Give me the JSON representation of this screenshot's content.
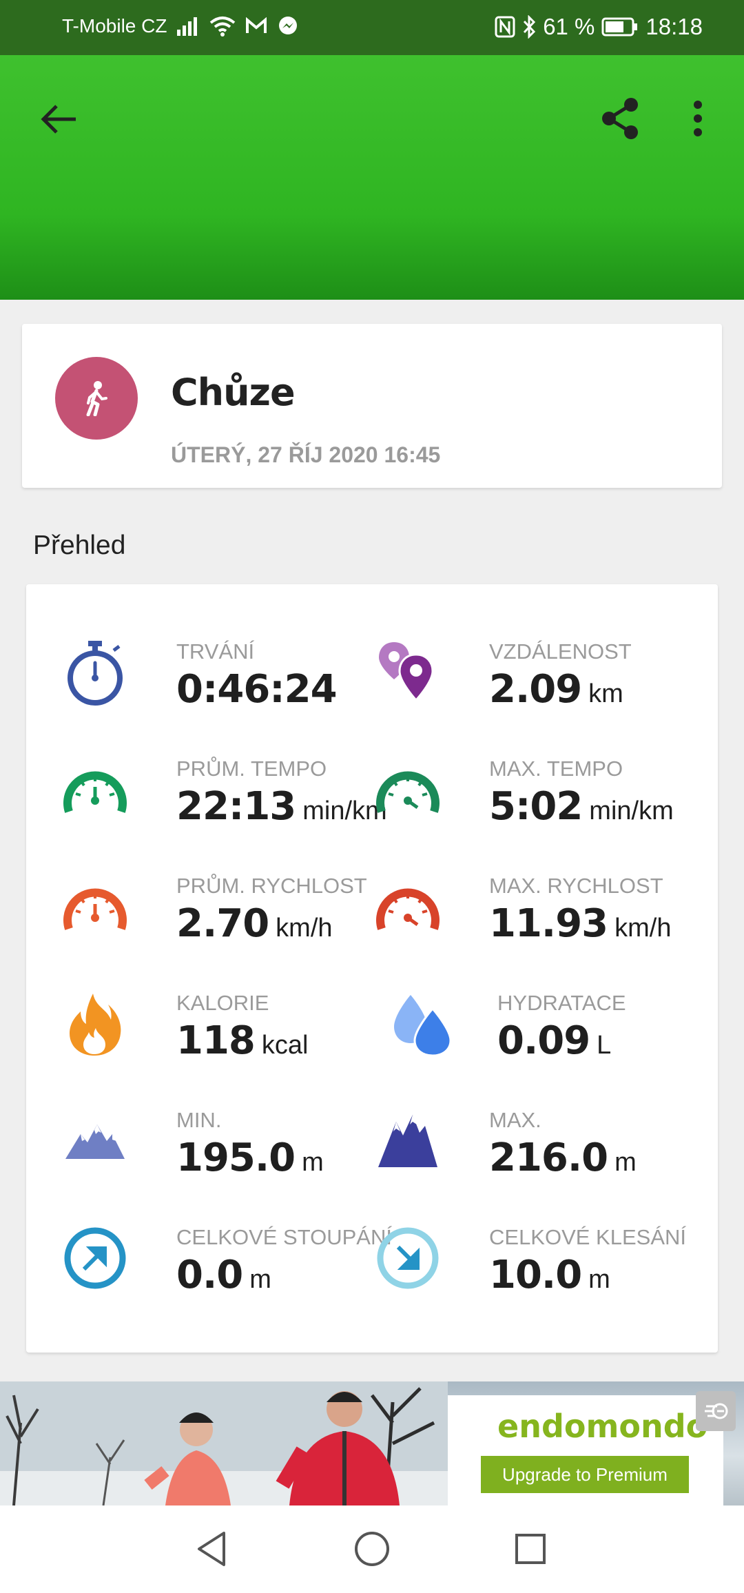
{
  "status_bar": {
    "carrier": "T-Mobile CZ",
    "battery": "61 %",
    "time": "18:18"
  },
  "header": {
    "back_icon": "arrow-back-icon",
    "share_icon": "share-icon",
    "more_icon": "more-vert-icon",
    "color": "#35bb26"
  },
  "activity": {
    "title": "Chůze",
    "date": "ÚTERÝ, 27 ŘÍJ 2020 16:45",
    "icon": "walking-icon",
    "color": "#c45274"
  },
  "overview": {
    "title": "Přehled",
    "stats": [
      {
        "label": "TRVÁNÍ",
        "value": "0:46:24",
        "unit": "",
        "icon": "stopwatch-icon",
        "color": "#3a55a4"
      },
      {
        "label": "VZDÁLENOST",
        "value": "2.09",
        "unit": "km",
        "icon": "location-pins-icon",
        "color": "#8a3a9b"
      },
      {
        "label": "PRŮM. TEMPO",
        "value": "22:13",
        "unit": "min/km",
        "icon": "speedometer-icon",
        "color": "#159c5b"
      },
      {
        "label": "MAX. TEMPO",
        "value": "5:02",
        "unit": "min/km",
        "icon": "speedometer-icon",
        "color": "#1b8a59"
      },
      {
        "label": "PRŮM. RYCHLOST",
        "value": "2.70",
        "unit": "km/h",
        "icon": "speedometer-icon",
        "color": "#e65a2e"
      },
      {
        "label": "MAX. RYCHLOST",
        "value": "11.93",
        "unit": "km/h",
        "icon": "speedometer-icon",
        "color": "#d8432a"
      },
      {
        "label": "KALORIE",
        "value": "118",
        "unit": "kcal",
        "icon": "flame-icon",
        "color": "#f29422"
      },
      {
        "label": "HYDRATACE",
        "value": "0.09",
        "unit": "L",
        "icon": "water-drops-icon",
        "color": "#4f8ef0"
      },
      {
        "label": "MIN.",
        "value": "195.0",
        "unit": "m",
        "icon": "mountains-icon",
        "color": "#6f7fc4"
      },
      {
        "label": "MAX.",
        "value": "216.0",
        "unit": "m",
        "icon": "mountains-icon",
        "color": "#3b3f9c"
      },
      {
        "label": "CELKOVÉ STOUPÁNÍ",
        "value": "0.0",
        "unit": "m",
        "icon": "ascent-arrow-icon",
        "color": "#2593c6"
      },
      {
        "label": "CELKOVÉ KLESÁNÍ",
        "value": "10.0",
        "unit": "m",
        "icon": "descent-arrow-icon",
        "color": "#8fd3e6"
      }
    ]
  },
  "ad": {
    "brand": "endomondo",
    "button": "Upgrade to Premium",
    "close_icon": "ad-close-icon"
  },
  "nav": {
    "back_icon": "nav-back-icon",
    "home_icon": "nav-home-icon",
    "recents_icon": "nav-recents-icon"
  }
}
